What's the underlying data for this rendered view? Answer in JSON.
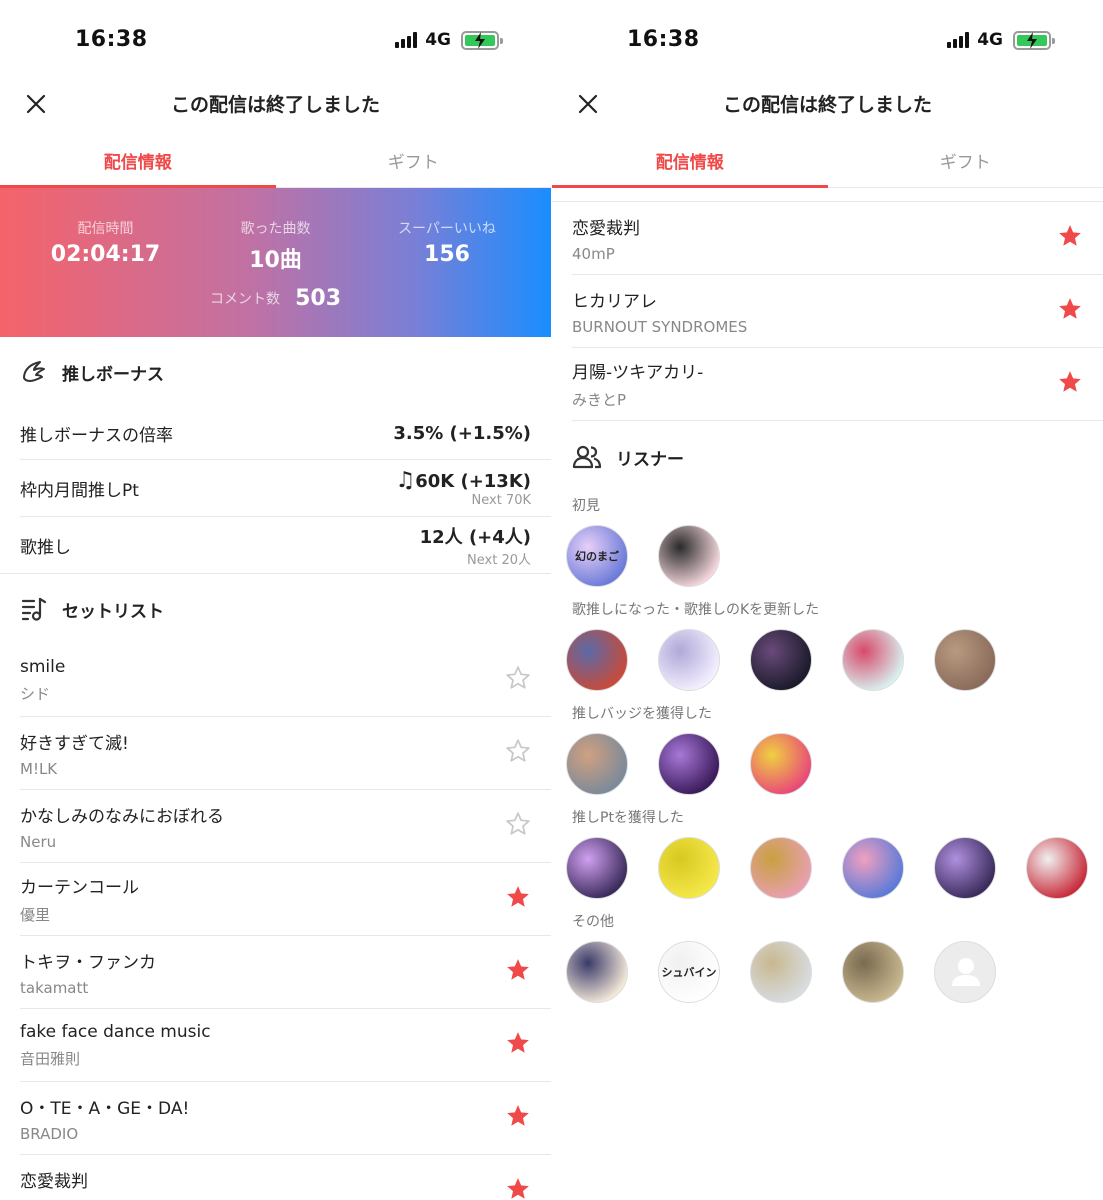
{
  "status_bar": {
    "time": "16:38",
    "network": "4G"
  },
  "header": {
    "title": "この配信は終了しました"
  },
  "tabs": [
    {
      "label": "配信情報",
      "active": true
    },
    {
      "label": "ギフト",
      "active": false
    }
  ],
  "stats": {
    "duration": {
      "label": "配信時間",
      "value": "02:04:17"
    },
    "songs": {
      "label": "歌った曲数",
      "value": "10曲"
    },
    "super_likes": {
      "label": "スーパーいいね",
      "value": "156"
    },
    "comments": {
      "label": "コメント数",
      "value": "503"
    }
  },
  "bonus": {
    "title": "推しボーナス",
    "rows": [
      {
        "label": "推しボーナスの倍率",
        "value": "3.5% (+1.5%)",
        "sub": ""
      },
      {
        "label": "枠内月間推しPt",
        "value": "60K (+13K)",
        "sub": "Next 70K"
      },
      {
        "label": "歌推し",
        "value": "12人 (+4人)",
        "sub": "Next 20人"
      }
    ]
  },
  "setlist": {
    "title": "セットリスト",
    "songs": [
      {
        "title": "smile",
        "artist": "シド",
        "favorited": false
      },
      {
        "title": "好きすぎて滅!",
        "artist": "M!LK",
        "favorited": false
      },
      {
        "title": "かなしみのなみにおぼれる",
        "artist": "Neru",
        "favorited": false
      },
      {
        "title": "カーテンコール",
        "artist": "優里",
        "favorited": true
      },
      {
        "title": "トキヲ・ファンカ",
        "artist": "takamatt",
        "favorited": true
      },
      {
        "title": "fake face dance music",
        "artist": "音田雅則",
        "favorited": true
      },
      {
        "title": "O・TE・A・GE・DA!",
        "artist": "BRADIO",
        "favorited": true
      },
      {
        "title": "恋愛裁判",
        "artist": "40mP",
        "favorited": true
      },
      {
        "title": "ヒカリアレ",
        "artist": "BURNOUT SYNDROMES",
        "favorited": true
      },
      {
        "title": "月陽-ツキアカリ-",
        "artist": "みきとP",
        "favorited": true
      }
    ]
  },
  "listeners": {
    "title": "リスナー",
    "groups": [
      {
        "label": "初見",
        "avatars": [
          {
            "colors": [
              "#6a7ad8",
              "#e8d0f8"
            ],
            "text": "幻のまご"
          },
          {
            "colors": [
              "#f4d6dc",
              "#2a2a2a"
            ],
            "text": ""
          }
        ]
      },
      {
        "label": "歌推しになった・歌推しのKを更新した",
        "avatars": [
          {
            "colors": [
              "#c84a3a",
              "#5a6aa8"
            ],
            "text": ""
          },
          {
            "colors": [
              "#f4f0ff",
              "#b0a8d8"
            ],
            "text": ""
          },
          {
            "colors": [
              "#1a1a2a",
              "#6a4a7a"
            ],
            "text": ""
          },
          {
            "colors": [
              "#d8f0f0",
              "#d84a6a"
            ],
            "text": ""
          },
          {
            "colors": [
              "#8a6a5a",
              "#b89a80"
            ],
            "text": ""
          }
        ]
      },
      {
        "label": "推しバッジを獲得した",
        "avatars": [
          {
            "colors": [
              "#7a8a9a",
              "#d0a080"
            ],
            "text": ""
          },
          {
            "colors": [
              "#3a1a5a",
              "#a878d8"
            ],
            "text": ""
          },
          {
            "colors": [
              "#e8487a",
              "#f0d040"
            ],
            "text": ""
          }
        ]
      },
      {
        "label": "推しPtを獲得した",
        "avatars": [
          {
            "colors": [
              "#3a2a5a",
              "#d0a0f0"
            ],
            "text": ""
          },
          {
            "colors": [
              "#f4e84a",
              "#d8c820"
            ],
            "text": ""
          },
          {
            "colors": [
              "#e8a0b0",
              "#c8a040"
            ],
            "text": ""
          },
          {
            "colors": [
              "#5a7ad8",
              "#f0a0c0"
            ],
            "text": ""
          },
          {
            "colors": [
              "#3a2a5a",
              "#b090e0"
            ],
            "text": ""
          },
          {
            "colors": [
              "#c82a3a",
              "#f0f0f0"
            ],
            "text": ""
          }
        ]
      },
      {
        "label": "その他",
        "avatars": [
          {
            "colors": [
              "#f4e8d8",
              "#3a3a6a"
            ],
            "text": ""
          },
          {
            "colors": [
              "#ffffff",
              "#f0f0f0"
            ],
            "text": "シュバイン"
          },
          {
            "colors": [
              "#d8dce0",
              "#c8b890"
            ],
            "text": ""
          },
          {
            "colors": [
              "#c8b890",
              "#7a6a50"
            ],
            "text": ""
          },
          {
            "colors": [
              "#eaeaea",
              "#eaeaea"
            ],
            "text": "",
            "placeholder": true
          }
        ]
      }
    ]
  },
  "colors": {
    "accent": "#f0494a",
    "star_off": "#c8c8c8"
  }
}
